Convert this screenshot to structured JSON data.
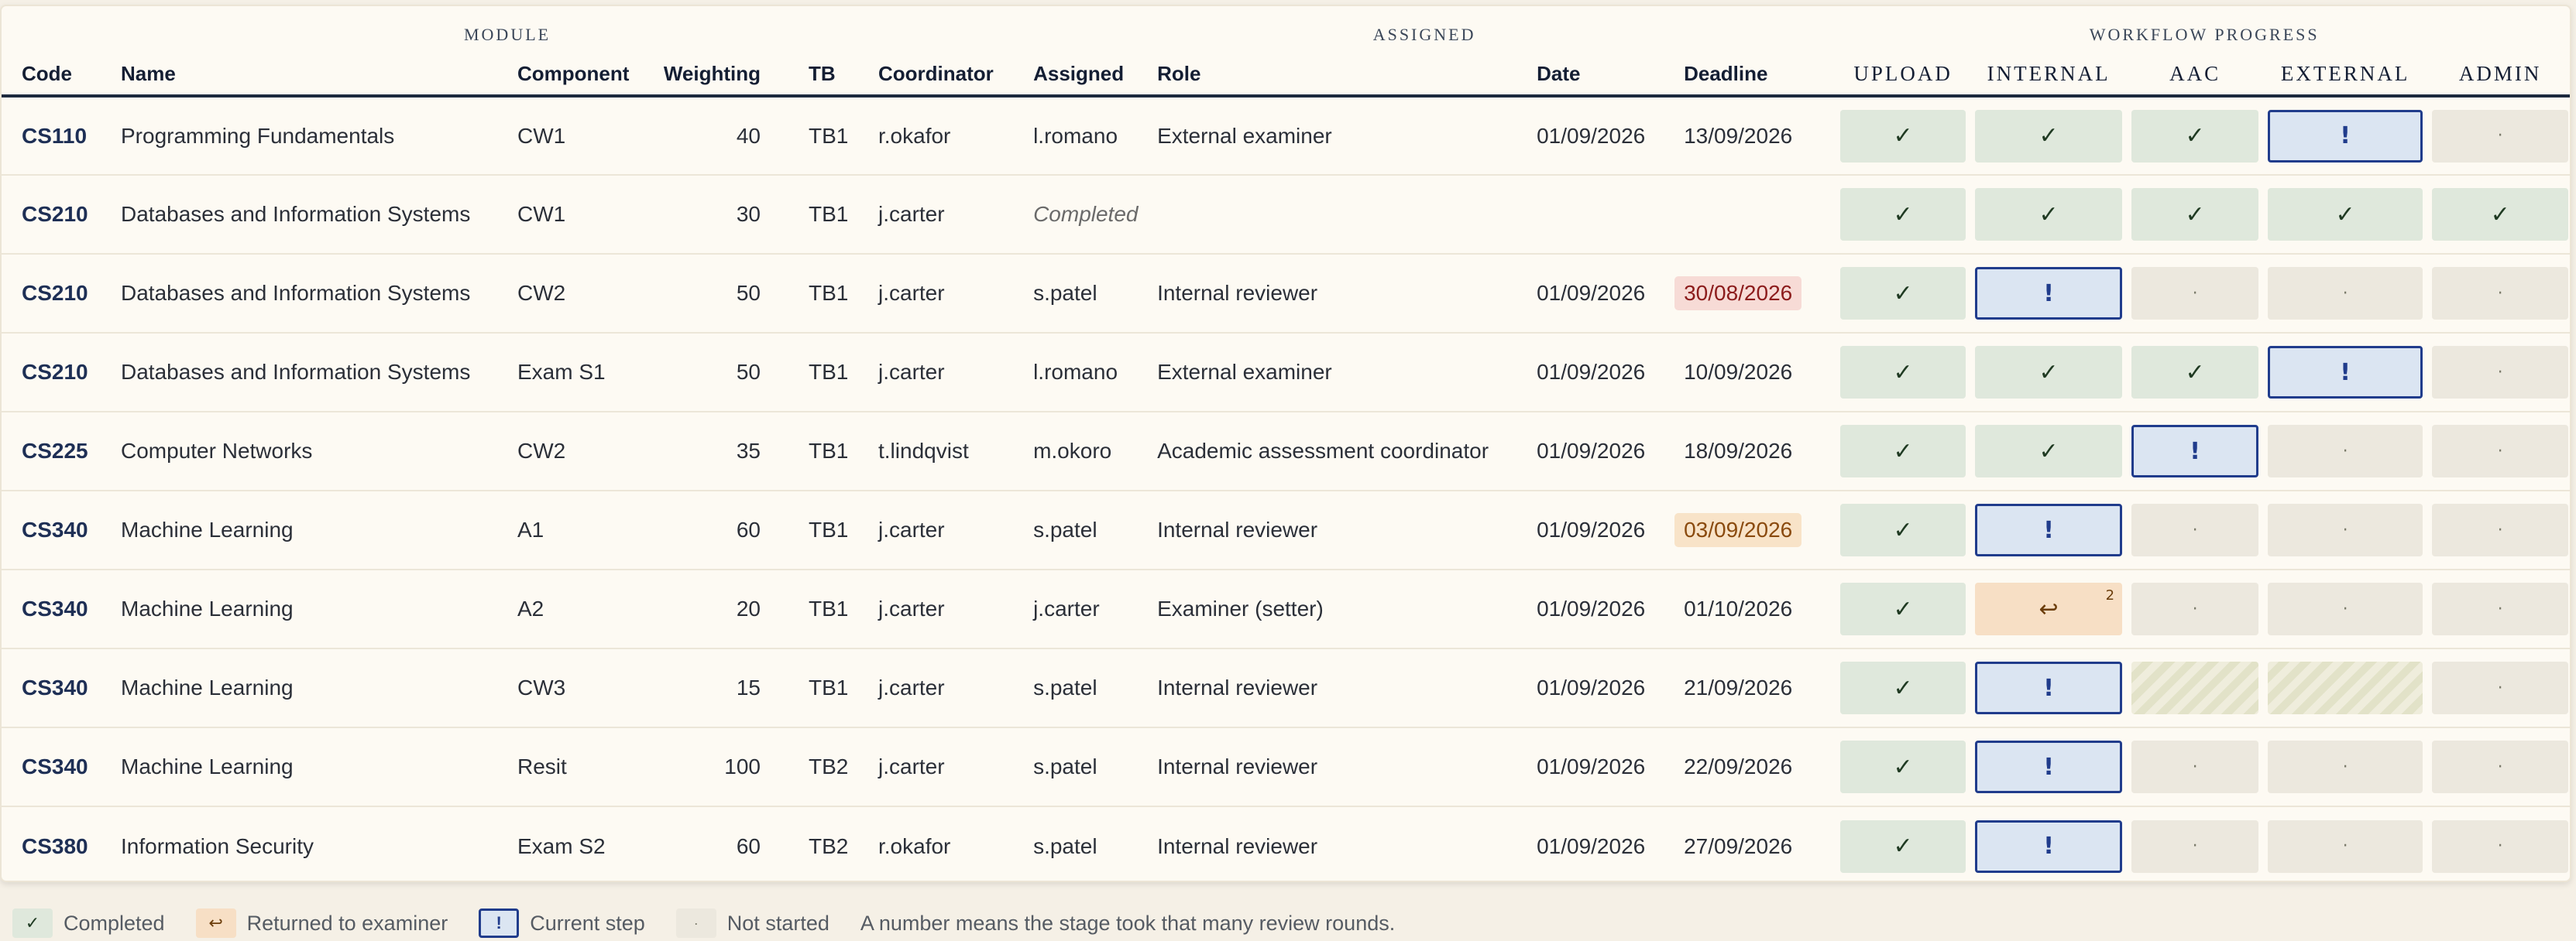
{
  "groups": {
    "module": "MODULE",
    "assigned": "ASSIGNED",
    "workflow": "WORKFLOW PROGRESS"
  },
  "columns": {
    "code": "Code",
    "name": "Name",
    "component": "Component",
    "weighting": "Weighting",
    "tb": "TB",
    "coordinator": "Coordinator",
    "assigned": "Assigned",
    "role": "Role",
    "date": "Date",
    "deadline": "Deadline",
    "upload": "UPLOAD",
    "internal": "INTERNAL",
    "aac": "AAC",
    "external": "EXTERNAL",
    "admin": "ADMIN"
  },
  "symbols": {
    "done": "✓",
    "current": "!",
    "pending": "·",
    "returned": "↩"
  },
  "rows": [
    {
      "code": "CS110",
      "name": "Programming Fundamentals",
      "component": "CW1",
      "weighting": "40",
      "tb": "TB1",
      "coordinator": "r.okafor",
      "assigned": "l.romano",
      "role": "External examiner",
      "date": "01/09/2026",
      "deadline": "13/09/2026",
      "deadline_status": "normal",
      "completed": "",
      "stages": [
        {
          "state": "done"
        },
        {
          "state": "done"
        },
        {
          "state": "done"
        },
        {
          "state": "current"
        },
        {
          "state": "pending"
        }
      ]
    },
    {
      "code": "CS210",
      "name": "Databases and Information Systems",
      "component": "CW1",
      "weighting": "30",
      "tb": "TB1",
      "coordinator": "j.carter",
      "assigned": "",
      "role": "",
      "date": "",
      "deadline": "",
      "deadline_status": "normal",
      "completed": "Completed",
      "stages": [
        {
          "state": "done"
        },
        {
          "state": "done"
        },
        {
          "state": "done"
        },
        {
          "state": "done"
        },
        {
          "state": "done"
        }
      ]
    },
    {
      "code": "CS210",
      "name": "Databases and Information Systems",
      "component": "CW2",
      "weighting": "50",
      "tb": "TB1",
      "coordinator": "j.carter",
      "assigned": "s.patel",
      "role": "Internal reviewer",
      "date": "01/09/2026",
      "deadline": "30/08/2026",
      "deadline_status": "overdue",
      "completed": "",
      "stages": [
        {
          "state": "done"
        },
        {
          "state": "current"
        },
        {
          "state": "pending"
        },
        {
          "state": "pending"
        },
        {
          "state": "pending"
        }
      ]
    },
    {
      "code": "CS210",
      "name": "Databases and Information Systems",
      "component": "Exam S1",
      "weighting": "50",
      "tb": "TB1",
      "coordinator": "j.carter",
      "assigned": "l.romano",
      "role": "External examiner",
      "date": "01/09/2026",
      "deadline": "10/09/2026",
      "deadline_status": "normal",
      "completed": "",
      "stages": [
        {
          "state": "done"
        },
        {
          "state": "done"
        },
        {
          "state": "done"
        },
        {
          "state": "current"
        },
        {
          "state": "pending"
        }
      ]
    },
    {
      "code": "CS225",
      "name": "Computer Networks",
      "component": "CW2",
      "weighting": "35",
      "tb": "TB1",
      "coordinator": "t.lindqvist",
      "assigned": "m.okoro",
      "role": "Academic assessment coordinator",
      "date": "01/09/2026",
      "deadline": "18/09/2026",
      "deadline_status": "normal",
      "completed": "",
      "stages": [
        {
          "state": "done"
        },
        {
          "state": "done"
        },
        {
          "state": "current"
        },
        {
          "state": "pending"
        },
        {
          "state": "pending"
        }
      ]
    },
    {
      "code": "CS340",
      "name": "Machine Learning",
      "component": "A1",
      "weighting": "60",
      "tb": "TB1",
      "coordinator": "j.carter",
      "assigned": "s.patel",
      "role": "Internal reviewer",
      "date": "01/09/2026",
      "deadline": "03/09/2026",
      "deadline_status": "due-soon",
      "completed": "",
      "stages": [
        {
          "state": "done"
        },
        {
          "state": "current"
        },
        {
          "state": "pending"
        },
        {
          "state": "pending"
        },
        {
          "state": "pending"
        }
      ]
    },
    {
      "code": "CS340",
      "name": "Machine Learning",
      "component": "A2",
      "weighting": "20",
      "tb": "TB1",
      "coordinator": "j.carter",
      "assigned": "j.carter",
      "role": "Examiner (setter)",
      "date": "01/09/2026",
      "deadline": "01/10/2026",
      "deadline_status": "normal",
      "completed": "",
      "stages": [
        {
          "state": "done"
        },
        {
          "state": "returned",
          "rounds": "2"
        },
        {
          "state": "pending"
        },
        {
          "state": "pending"
        },
        {
          "state": "pending"
        }
      ]
    },
    {
      "code": "CS340",
      "name": "Machine Learning",
      "component": "CW3",
      "weighting": "15",
      "tb": "TB1",
      "coordinator": "j.carter",
      "assigned": "s.patel",
      "role": "Internal reviewer",
      "date": "01/09/2026",
      "deadline": "21/09/2026",
      "deadline_status": "normal",
      "completed": "",
      "stages": [
        {
          "state": "done"
        },
        {
          "state": "current"
        },
        {
          "state": "skipped"
        },
        {
          "state": "skipped"
        },
        {
          "state": "pending"
        }
      ]
    },
    {
      "code": "CS340",
      "name": "Machine Learning",
      "component": "Resit",
      "weighting": "100",
      "tb": "TB2",
      "coordinator": "j.carter",
      "assigned": "s.patel",
      "role": "Internal reviewer",
      "date": "01/09/2026",
      "deadline": "22/09/2026",
      "deadline_status": "normal",
      "completed": "",
      "stages": [
        {
          "state": "done"
        },
        {
          "state": "current"
        },
        {
          "state": "pending"
        },
        {
          "state": "pending"
        },
        {
          "state": "pending"
        }
      ]
    },
    {
      "code": "CS380",
      "name": "Information Security",
      "component": "Exam S2",
      "weighting": "60",
      "tb": "TB2",
      "coordinator": "r.okafor",
      "assigned": "s.patel",
      "role": "Internal reviewer",
      "date": "01/09/2026",
      "deadline": "27/09/2026",
      "deadline_status": "normal",
      "completed": "",
      "stages": [
        {
          "state": "done"
        },
        {
          "state": "current"
        },
        {
          "state": "pending"
        },
        {
          "state": "pending"
        },
        {
          "state": "pending"
        }
      ]
    }
  ],
  "legend": {
    "completed": "Completed",
    "returned": "Returned to examiner",
    "current": "Current step",
    "not_started": "Not started",
    "note": "A number means the stage took that many review rounds."
  }
}
